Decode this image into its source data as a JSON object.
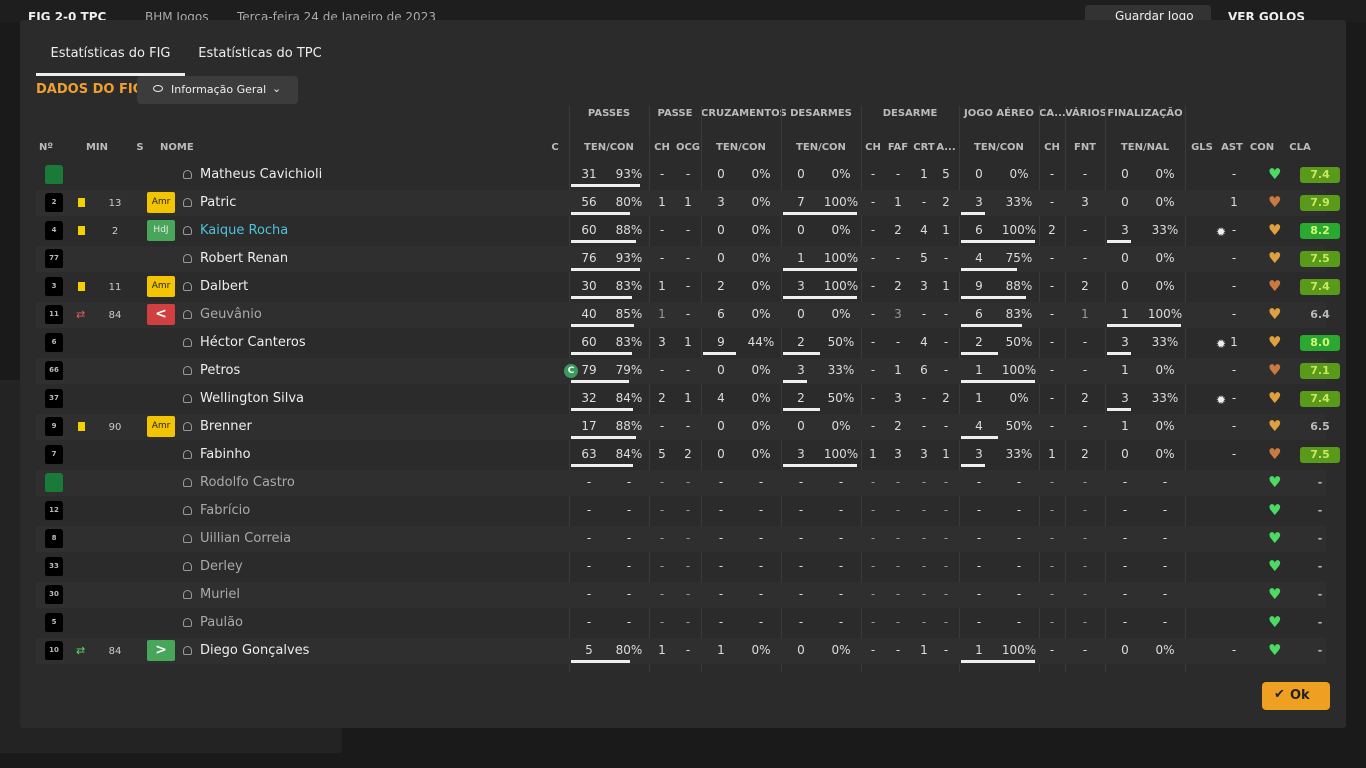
{
  "background": {
    "score": "FIG 2-0 TPC",
    "competition": "BHM Jogos",
    "date": "Terça-feira 24 de Janeiro de 2023",
    "save_label": "Guardar Jogo",
    "goals_label": "VER GOLOS"
  },
  "tabs": [
    "Estatísticas do FIG",
    "Estatísticas do TPC"
  ],
  "section_title": "DADOS DO FIG",
  "view_dropdown": "Informação Geral",
  "ok_label": "Ok",
  "groups": [
    "PASSES",
    "PASSE",
    "CRUZAMENTOS",
    "DESARMES",
    "DESARME",
    "JOGO AÉREO",
    "CA...",
    "VÁRIOS",
    "FINALIZAÇÃO"
  ],
  "headers": {
    "num": "Nº",
    "min": "MIN",
    "s": "S",
    "nome": "NOME",
    "c": "C",
    "passes": "TEN/CON",
    "passe_ch": "CH",
    "passe_ocg": "OCG",
    "cruz": "TEN/CON",
    "desarmes": "TEN/CON",
    "des_ch": "CH",
    "des_faf": "FAF",
    "des_crt": "CRT",
    "des_a": "A...",
    "aereo": "TEN/CON",
    "ca_ch": "CH",
    "var_fnt": "FNT",
    "fin": "TEN/NAL",
    "gls": "GLS",
    "ast": "AST",
    "con": "CON",
    "cla": "CLA"
  },
  "players": [
    {
      "num": "",
      "gk": true,
      "card": false,
      "sub": "",
      "min": "",
      "badge": "",
      "badge_type": "",
      "name": "Matheus Cavichioli",
      "style": "",
      "captain": false,
      "pas": [
        "31",
        "93%"
      ],
      "pas_bar": 0.93,
      "pch": "-",
      "pocg": "-",
      "cru": [
        "0",
        "0%"
      ],
      "cru_bar": 0,
      "dsm": [
        "0",
        "0%"
      ],
      "dsm_bar": 0,
      "dch": "-",
      "dfaf": "-",
      "dcrt": "1",
      "da": "5",
      "aer": [
        "0",
        "0%"
      ],
      "aer_bar": 0,
      "cach": "-",
      "fnt": "-",
      "fin": [
        "0",
        "0%"
      ],
      "fin_bar": 0,
      "ball": false,
      "ast": "-",
      "heart": "#4cd964",
      "cla": "7.4",
      "cla_type": "r-good"
    },
    {
      "num": "2",
      "gk": false,
      "card": true,
      "sub": "",
      "min": "13",
      "badge": "Amr",
      "badge_type": "amr",
      "name": "Patric",
      "style": "",
      "captain": false,
      "pas": [
        "56",
        "80%"
      ],
      "pas_bar": 0.8,
      "pch": "1",
      "pocg": "1",
      "cru": [
        "3",
        "0%"
      ],
      "cru_bar": 0,
      "dsm": [
        "7",
        "100%"
      ],
      "dsm_bar": 1,
      "dch": "-",
      "dfaf": "1",
      "dcrt": "-",
      "da": "2",
      "aer": [
        "3",
        "33%"
      ],
      "aer_bar": 0.33,
      "cach": "-",
      "fnt": "3",
      "fin": [
        "0",
        "0%"
      ],
      "fin_bar": 0,
      "ball": false,
      "ast": "1",
      "heart": "#c97a40",
      "cla": "7.9",
      "cla_type": "r-good"
    },
    {
      "num": "4",
      "gk": false,
      "card": true,
      "sub": "",
      "min": "2",
      "badge": "HdJ",
      "badge_type": "hdi",
      "name": "Kaique Rocha",
      "style": "link",
      "captain": false,
      "pas": [
        "60",
        "88%"
      ],
      "pas_bar": 0.88,
      "pch": "-",
      "pocg": "-",
      "cru": [
        "0",
        "0%"
      ],
      "cru_bar": 0,
      "dsm": [
        "0",
        "0%"
      ],
      "dsm_bar": 0,
      "dch": "-",
      "dfaf": "2",
      "dcrt": "4",
      "da": "1",
      "aer": [
        "6",
        "100%"
      ],
      "aer_bar": 1,
      "cach": "2",
      "fnt": "-",
      "fin": [
        "3",
        "33%"
      ],
      "fin_bar": 0.33,
      "ball": true,
      "ast": "-",
      "heart": "#e0a040",
      "cla": "8.2",
      "cla_type": "r-great"
    },
    {
      "num": "77",
      "gk": false,
      "card": false,
      "sub": "",
      "min": "",
      "badge": "",
      "badge_type": "",
      "name": "Robert Renan",
      "style": "",
      "captain": false,
      "pas": [
        "76",
        "93%"
      ],
      "pas_bar": 0.93,
      "pch": "-",
      "pocg": "-",
      "cru": [
        "0",
        "0%"
      ],
      "cru_bar": 0,
      "dsm": [
        "1",
        "100%"
      ],
      "dsm_bar": 1,
      "dch": "-",
      "dfaf": "-",
      "dcrt": "5",
      "da": "-",
      "aer": [
        "4",
        "75%"
      ],
      "aer_bar": 0.75,
      "cach": "-",
      "fnt": "-",
      "fin": [
        "0",
        "0%"
      ],
      "fin_bar": 0,
      "ball": false,
      "ast": "-",
      "heart": "#e0a040",
      "cla": "7.5",
      "cla_type": "r-good"
    },
    {
      "num": "3",
      "gk": false,
      "card": true,
      "sub": "",
      "min": "11",
      "badge": "Amr",
      "badge_type": "amr",
      "name": "Dalbert",
      "style": "",
      "captain": false,
      "pas": [
        "30",
        "83%"
      ],
      "pas_bar": 0.83,
      "pch": "1",
      "pocg": "-",
      "cru": [
        "2",
        "0%"
      ],
      "cru_bar": 0,
      "dsm": [
        "3",
        "100%"
      ],
      "dsm_bar": 1,
      "dch": "-",
      "dfaf": "2",
      "dcrt": "3",
      "da": "1",
      "aer": [
        "9",
        "88%"
      ],
      "aer_bar": 0.88,
      "cach": "-",
      "fnt": "2",
      "fin": [
        "0",
        "0%"
      ],
      "fin_bar": 0,
      "ball": false,
      "ast": "-",
      "heart": "#c97a40",
      "cla": "7.4",
      "cla_type": "r-good"
    },
    {
      "num": "11",
      "gk": false,
      "card": false,
      "sub": "out",
      "min": "84",
      "badge": "<",
      "badge_type": "red",
      "name": "Geuvânio",
      "style": "dim",
      "captain": false,
      "pas": [
        "40",
        "85%"
      ],
      "pas_bar": 0.85,
      "pch": "1",
      "pocg": "-",
      "cru": [
        "6",
        "0%"
      ],
      "cru_bar": 0,
      "dsm": [
        "0",
        "0%"
      ],
      "dsm_bar": 0,
      "dch": "-",
      "dfaf": "3",
      "dcrt": "-",
      "da": "-",
      "aer": [
        "6",
        "83%"
      ],
      "aer_bar": 0.83,
      "cach": "-",
      "fnt": "1",
      "fin": [
        "1",
        "100%"
      ],
      "fin_bar": 1,
      "ball": false,
      "ast": "-",
      "heart": "#e0a040",
      "cla": "6.4",
      "cla_type": "r-mid"
    },
    {
      "num": "6",
      "gk": false,
      "card": false,
      "sub": "",
      "min": "",
      "badge": "",
      "badge_type": "",
      "name": "Héctor Canteros",
      "style": "",
      "captain": false,
      "pas": [
        "60",
        "83%"
      ],
      "pas_bar": 0.83,
      "pch": "3",
      "pocg": "1",
      "cru": [
        "9",
        "44%"
      ],
      "cru_bar": 0.44,
      "dsm": [
        "2",
        "50%"
      ],
      "dsm_bar": 0.5,
      "dch": "-",
      "dfaf": "-",
      "dcrt": "4",
      "da": "-",
      "aer": [
        "2",
        "50%"
      ],
      "aer_bar": 0.5,
      "cach": "-",
      "fnt": "-",
      "fin": [
        "3",
        "33%"
      ],
      "fin_bar": 0.33,
      "ball": true,
      "ast": "1",
      "heart": "#e0a040",
      "cla": "8.0",
      "cla_type": "r-great"
    },
    {
      "num": "66",
      "gk": false,
      "card": false,
      "sub": "",
      "min": "",
      "badge": "",
      "badge_type": "",
      "name": "Petros",
      "style": "",
      "captain": true,
      "pas": [
        "79",
        "79%"
      ],
      "pas_bar": 0.79,
      "pch": "-",
      "pocg": "-",
      "cru": [
        "0",
        "0%"
      ],
      "cru_bar": 0,
      "dsm": [
        "3",
        "33%"
      ],
      "dsm_bar": 0.33,
      "dch": "-",
      "dfaf": "1",
      "dcrt": "6",
      "da": "-",
      "aer": [
        "1",
        "100%"
      ],
      "aer_bar": 1,
      "cach": "-",
      "fnt": "-",
      "fin": [
        "1",
        "0%"
      ],
      "fin_bar": 0,
      "ball": false,
      "ast": "-",
      "heart": "#c97a40",
      "cla": "7.1",
      "cla_type": "r-good"
    },
    {
      "num": "37",
      "gk": false,
      "card": false,
      "sub": "",
      "min": "",
      "badge": "",
      "badge_type": "",
      "name": "Wellington Silva",
      "style": "",
      "captain": false,
      "pas": [
        "32",
        "84%"
      ],
      "pas_bar": 0.84,
      "pch": "2",
      "pocg": "1",
      "cru": [
        "4",
        "0%"
      ],
      "cru_bar": 0,
      "dsm": [
        "2",
        "50%"
      ],
      "dsm_bar": 0.5,
      "dch": "-",
      "dfaf": "3",
      "dcrt": "-",
      "da": "2",
      "aer": [
        "1",
        "0%"
      ],
      "aer_bar": 0,
      "cach": "-",
      "fnt": "2",
      "fin": [
        "3",
        "33%"
      ],
      "fin_bar": 0.33,
      "ball": true,
      "ast": "-",
      "heart": "#e0a040",
      "cla": "7.4",
      "cla_type": "r-good"
    },
    {
      "num": "9",
      "gk": false,
      "card": true,
      "sub": "",
      "min": "90",
      "badge": "Amr",
      "badge_type": "amr",
      "name": "Brenner",
      "style": "",
      "captain": false,
      "pas": [
        "17",
        "88%"
      ],
      "pas_bar": 0.88,
      "pch": "-",
      "pocg": "-",
      "cru": [
        "0",
        "0%"
      ],
      "cru_bar": 0,
      "dsm": [
        "0",
        "0%"
      ],
      "dsm_bar": 0,
      "dch": "-",
      "dfaf": "2",
      "dcrt": "-",
      "da": "-",
      "aer": [
        "4",
        "50%"
      ],
      "aer_bar": 0.5,
      "cach": "-",
      "fnt": "-",
      "fin": [
        "1",
        "0%"
      ],
      "fin_bar": 0,
      "ball": false,
      "ast": "-",
      "heart": "#e0a040",
      "cla": "6.5",
      "cla_type": "r-mid"
    },
    {
      "num": "7",
      "gk": false,
      "card": false,
      "sub": "",
      "min": "",
      "badge": "",
      "badge_type": "",
      "name": "Fabinho",
      "style": "",
      "captain": false,
      "pas": [
        "63",
        "84%"
      ],
      "pas_bar": 0.84,
      "pch": "5",
      "pocg": "2",
      "cru": [
        "0",
        "0%"
      ],
      "cru_bar": 0,
      "dsm": [
        "3",
        "100%"
      ],
      "dsm_bar": 1,
      "dch": "1",
      "dfaf": "3",
      "dcrt": "3",
      "da": "1",
      "aer": [
        "3",
        "33%"
      ],
      "aer_bar": 0.33,
      "cach": "1",
      "fnt": "2",
      "fin": [
        "0",
        "0%"
      ],
      "fin_bar": 0,
      "ball": false,
      "ast": "-",
      "heart": "#c97a40",
      "cla": "7.5",
      "cla_type": "r-good"
    },
    {
      "num": "",
      "gk": true,
      "card": false,
      "sub": "",
      "min": "",
      "badge": "",
      "badge_type": "",
      "name": "Rodolfo Castro",
      "style": "dim",
      "captain": false,
      "empty": true,
      "heart": "#4cd964",
      "cla": "-",
      "cla_type": "r-mid"
    },
    {
      "num": "12",
      "gk": false,
      "card": false,
      "sub": "",
      "min": "",
      "badge": "",
      "badge_type": "",
      "name": "Fabrício",
      "style": "dim",
      "captain": false,
      "empty": true,
      "heart": "#4cd964",
      "cla": "-",
      "cla_type": "r-mid"
    },
    {
      "num": "8",
      "gk": false,
      "card": false,
      "sub": "",
      "min": "",
      "badge": "",
      "badge_type": "",
      "name": "Uillian Correia",
      "style": "dim",
      "captain": false,
      "empty": true,
      "heart": "#4cd964",
      "cla": "-",
      "cla_type": "r-mid"
    },
    {
      "num": "33",
      "gk": false,
      "card": false,
      "sub": "",
      "min": "",
      "badge": "",
      "badge_type": "",
      "name": "Derley",
      "style": "dim",
      "captain": false,
      "empty": true,
      "heart": "#4cd964",
      "cla": "-",
      "cla_type": "r-mid"
    },
    {
      "num": "30",
      "gk": false,
      "card": false,
      "sub": "",
      "min": "",
      "badge": "",
      "badge_type": "",
      "name": "Muriel",
      "style": "dim",
      "captain": false,
      "empty": true,
      "heart": "#4cd964",
      "cla": "-",
      "cla_type": "r-mid"
    },
    {
      "num": "5",
      "gk": false,
      "card": false,
      "sub": "",
      "min": "",
      "badge": "",
      "badge_type": "",
      "name": "Paulão",
      "style": "dim",
      "captain": false,
      "empty": true,
      "heart": "#4cd964",
      "cla": "-",
      "cla_type": "r-mid"
    },
    {
      "num": "10",
      "gk": false,
      "card": false,
      "sub": "in",
      "min": "84",
      "badge": ">",
      "badge_type": "grn",
      "name": "Diego Gonçalves",
      "style": "",
      "captain": false,
      "pas": [
        "5",
        "80%"
      ],
      "pas_bar": 0.8,
      "pch": "1",
      "pocg": "-",
      "cru": [
        "1",
        "0%"
      ],
      "cru_bar": 0,
      "dsm": [
        "0",
        "0%"
      ],
      "dsm_bar": 0,
      "dch": "-",
      "dfaf": "-",
      "dcrt": "1",
      "da": "-",
      "aer": [
        "1",
        "100%"
      ],
      "aer_bar": 1,
      "cach": "-",
      "fnt": "-",
      "fin": [
        "0",
        "0%"
      ],
      "fin_bar": 0,
      "ball": false,
      "ast": "-",
      "heart": "#4cd964",
      "cla": "-",
      "cla_type": "r-mid"
    }
  ]
}
